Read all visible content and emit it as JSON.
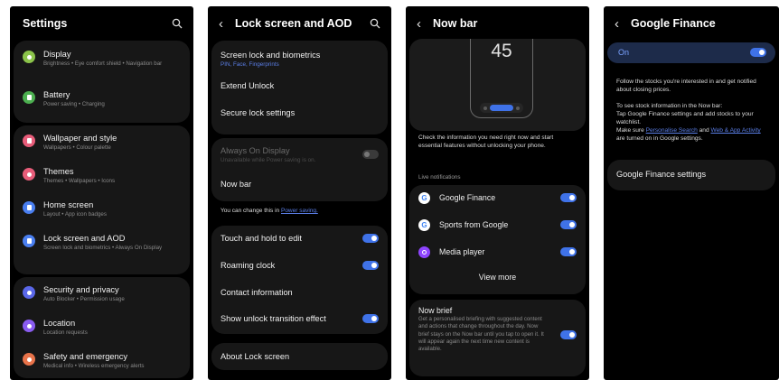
{
  "settings": {
    "title": "Settings",
    "items": [
      {
        "label": "Display",
        "sub": "Brightness  •  Eye comfort shield  •  Navigation bar",
        "color": "#8bc34a"
      },
      {
        "label": "Battery",
        "sub": "Power saving  •  Charging",
        "color": "#4caf50"
      },
      {
        "label": "Wallpaper and style",
        "sub": "Wallpapers  •  Colour palette",
        "color": "#e85d7a"
      },
      {
        "label": "Themes",
        "sub": "Themes  •  Wallpapers  •  Icons",
        "color": "#e85d7a"
      },
      {
        "label": "Home screen",
        "sub": "Layout  •  App icon badges",
        "color": "#4a7ff0"
      },
      {
        "label": "Lock screen and AOD",
        "sub": "Screen lock and biometrics  •  Always On Display",
        "color": "#4a7ff0"
      },
      {
        "label": "Security and privacy",
        "sub": "Auto Blocker  •  Permission usage",
        "color": "#5a67e8"
      },
      {
        "label": "Location",
        "sub": "Location requests",
        "color": "#8a5cf0"
      },
      {
        "label": "Safety and emergency",
        "sub": "Medical info  •  Wireless emergency alerts",
        "color": "#e8734a"
      }
    ]
  },
  "lock": {
    "title": "Lock screen and AOD",
    "screen_lock": "Screen lock and biometrics",
    "screen_lock_sub": "PIN, Face, Fingerprints",
    "extend_unlock": "Extend Unlock",
    "secure_lock": "Secure lock settings",
    "aod": "Always On Display",
    "aod_sub": "Unavailable while Power saving is on.",
    "now_bar": "Now bar",
    "change_note": "You can change this in ",
    "power_saving": "Power saving.",
    "touch_hold": "Touch and hold to edit",
    "roaming_clock": "Roaming clock",
    "contact_info": "Contact information",
    "unlock_effect": "Show unlock transition effect",
    "about": "About Lock screen"
  },
  "nowbar": {
    "title": "Now bar",
    "clock": "45",
    "intro": "Check the information you need right now and start essential features without unlocking your phone.",
    "live_label": "Live notifications",
    "apps": [
      {
        "label": "Google Finance"
      },
      {
        "label": "Sports from Google"
      },
      {
        "label": "Media player"
      }
    ],
    "view_more": "View more",
    "brief_title": "Now brief",
    "brief_desc": "Get a personalised briefing with suggested content and actions that change throughout the day. Now brief stays on the Now bar until you tap to open it. It will appear again the next time new content is available."
  },
  "finance": {
    "title": "Google Finance",
    "on_label": "On",
    "desc1": "Follow the stocks you're interested in and get notified about closing prices.",
    "desc2a": "To see stock information in the Now bar:",
    "desc2b": "Tap Google Finance settings and add stocks to your watchlist.",
    "desc2c": "Make sure ",
    "link1": "Personalise Search",
    "desc2d": " and ",
    "link2": "Web & App Activity",
    "desc2e": " are turned on in Google settings.",
    "settings_label": "Google Finance settings"
  },
  "colors": {
    "accent": "#3f72e8",
    "card": "#171717",
    "background": "#000000"
  }
}
